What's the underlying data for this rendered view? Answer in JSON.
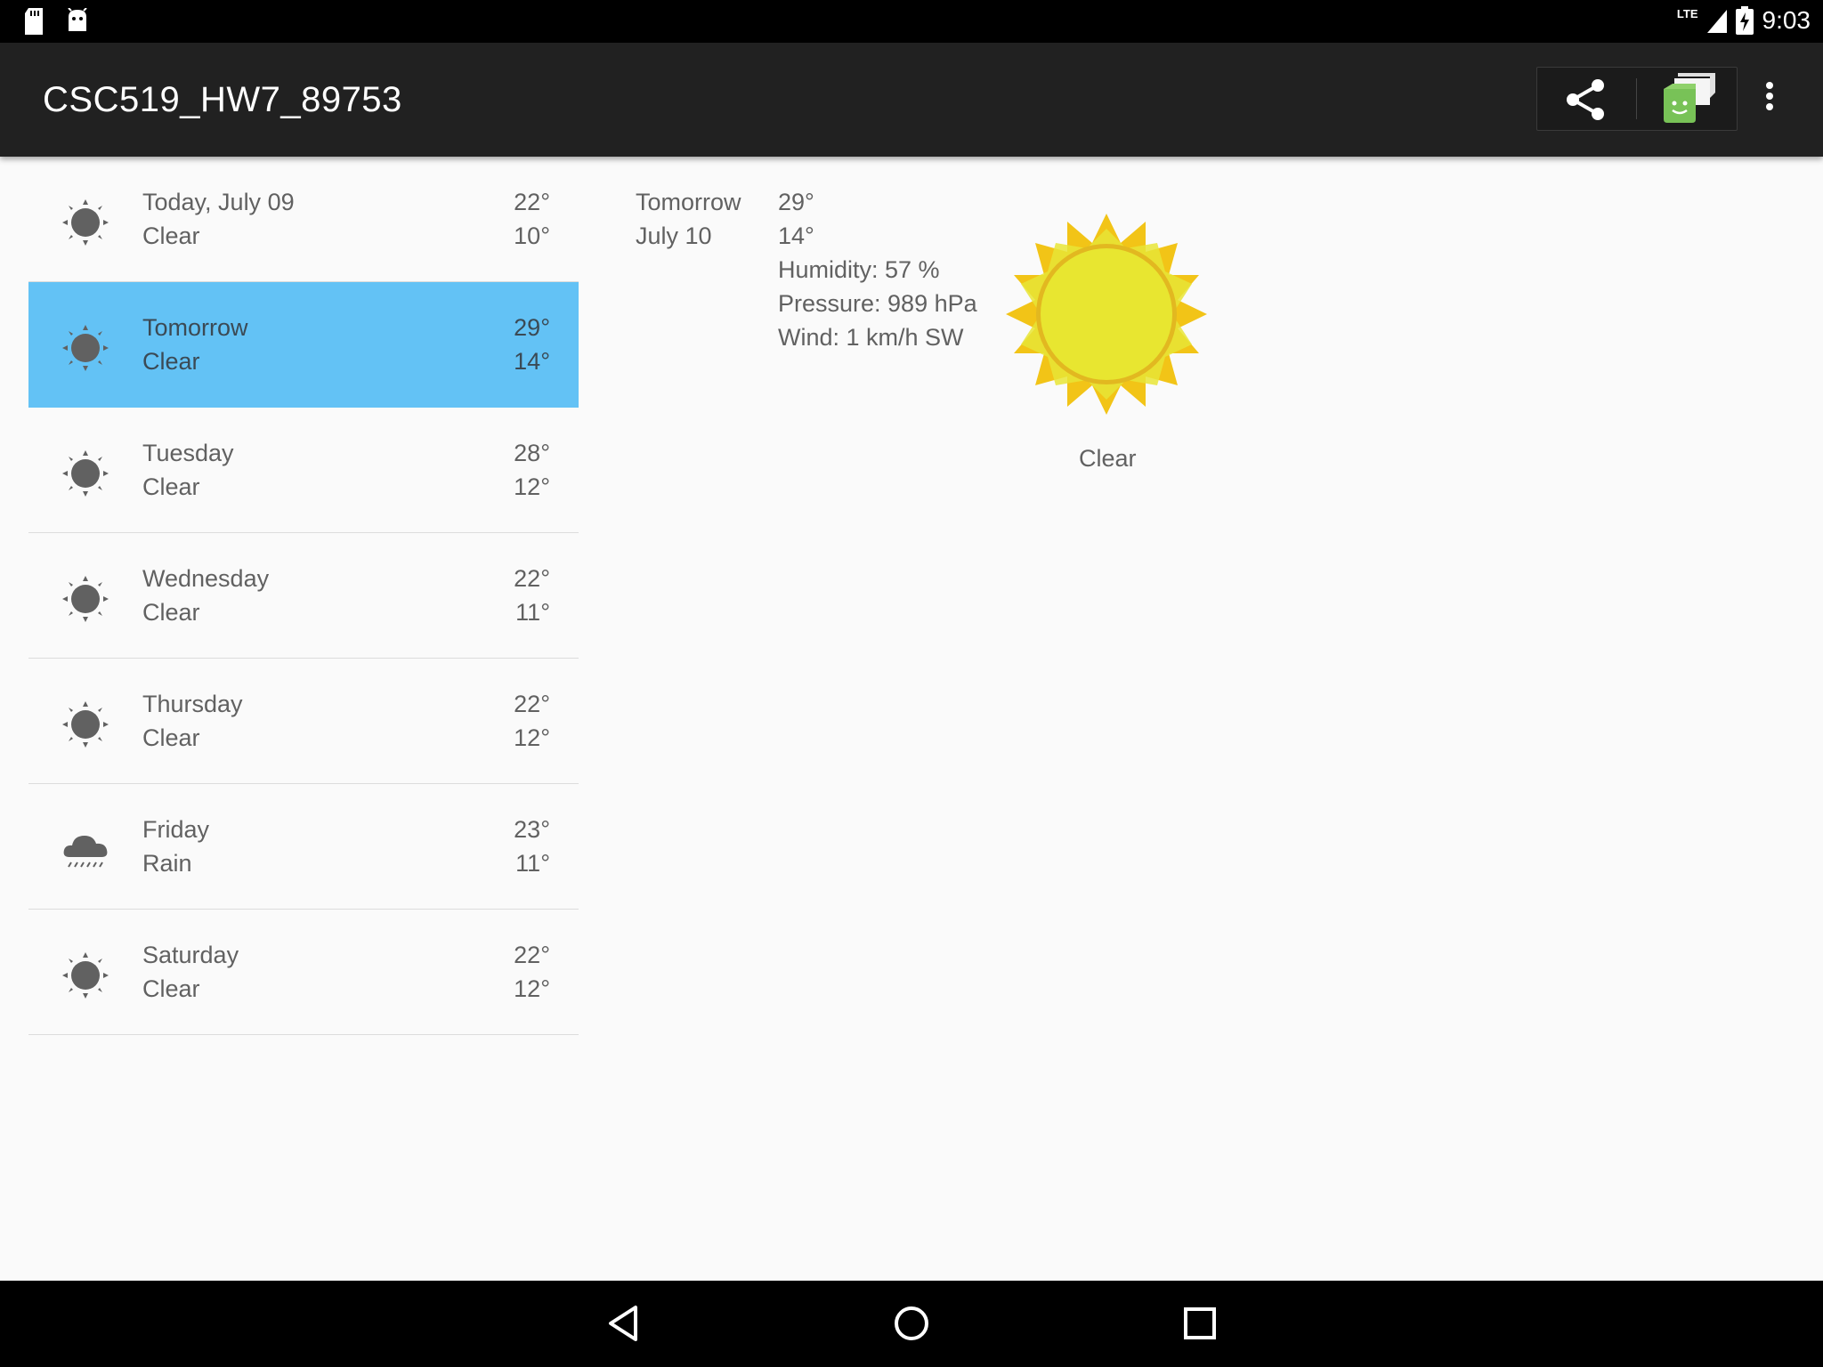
{
  "status_bar": {
    "time": "9:03",
    "network": "LTE",
    "icons": [
      "sd-card-icon",
      "android-debug-icon",
      "signal-icon",
      "battery-charging-icon"
    ]
  },
  "app_bar": {
    "title": "CSC519_HW7_89753",
    "actions": [
      "share-icon",
      "chat-app-icon",
      "overflow-menu-icon"
    ]
  },
  "forecast": [
    {
      "day": "Today, July 09",
      "desc": "Clear",
      "high": "22°",
      "low": "10°",
      "icon": "clear-icon",
      "selected": false
    },
    {
      "day": "Tomorrow",
      "desc": "Clear",
      "high": "29°",
      "low": "14°",
      "icon": "clear-icon",
      "selected": true
    },
    {
      "day": "Tuesday",
      "desc": "Clear",
      "high": "28°",
      "low": "12°",
      "icon": "clear-icon",
      "selected": false
    },
    {
      "day": "Wednesday",
      "desc": "Clear",
      "high": "22°",
      "low": "11°",
      "icon": "clear-icon",
      "selected": false
    },
    {
      "day": "Thursday",
      "desc": "Clear",
      "high": "22°",
      "low": "12°",
      "icon": "clear-icon",
      "selected": false
    },
    {
      "day": "Friday",
      "desc": "Rain",
      "high": "23°",
      "low": "11°",
      "icon": "rain-icon",
      "selected": false
    },
    {
      "day": "Saturday",
      "desc": "Clear",
      "high": "22°",
      "low": "12°",
      "icon": "clear-icon",
      "selected": false
    }
  ],
  "detail": {
    "day": "Tomorrow",
    "date": "July 10",
    "high": "29°",
    "low": "14°",
    "humidity": "Humidity: 57 %",
    "pressure": "Pressure: 989 hPa",
    "wind": "Wind:  1 km/h SW",
    "condition": "Clear",
    "icon": "sun-art-icon"
  },
  "nav_bar": [
    "back-icon",
    "home-icon",
    "recents-icon"
  ],
  "colors": {
    "selected_row": "#63c2f5",
    "app_bar": "#212121",
    "text": "#616161",
    "sun": "#e8e02c"
  }
}
